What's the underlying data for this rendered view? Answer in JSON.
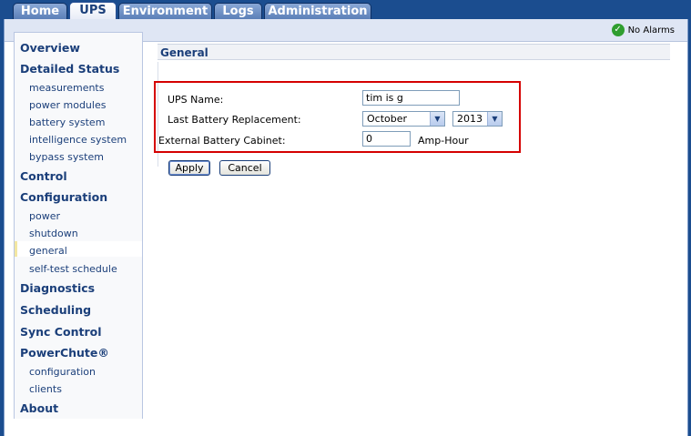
{
  "tabs": [
    {
      "label": "Home"
    },
    {
      "label": "UPS"
    },
    {
      "label": "Environment"
    },
    {
      "label": "Logs"
    },
    {
      "label": "Administration"
    }
  ],
  "status": {
    "alarm_text": "No Alarms",
    "alarm_icon": "check-circle-icon",
    "alarm_color": "#2f9e2f"
  },
  "sidebar": {
    "overview": "Overview",
    "detailed_status": "Detailed Status",
    "measurements": "measurements",
    "power_modules": "power modules",
    "battery_system": "battery system",
    "intelligence_system": "intelligence system",
    "bypass_system": "bypass system",
    "control": "Control",
    "configuration": "Configuration",
    "power": "power",
    "shutdown": "shutdown",
    "general": "general",
    "self_test_schedule": "self-test schedule",
    "diagnostics": "Diagnostics",
    "scheduling": "Scheduling",
    "sync_control": "Sync Control",
    "powerchute": "PowerChute®",
    "pc_configuration": "configuration",
    "pc_clients": "clients",
    "about": "About"
  },
  "main": {
    "section_title": "General",
    "ups_name_label": "UPS Name:",
    "ups_name_value": "tim is g",
    "battery_replacement_label": "Last Battery Replacement:",
    "month_value": "October",
    "year_value": "2013",
    "cabinet_label": "External Battery Cabinet:",
    "cabinet_value": "0",
    "cabinet_unit": "Amp-Hour",
    "apply_label": "Apply",
    "cancel_label": "Cancel"
  },
  "colors": {
    "highlight": "#d50000",
    "nav_text": "#1b3f7a",
    "tab_bg": "#1b4d8f"
  }
}
